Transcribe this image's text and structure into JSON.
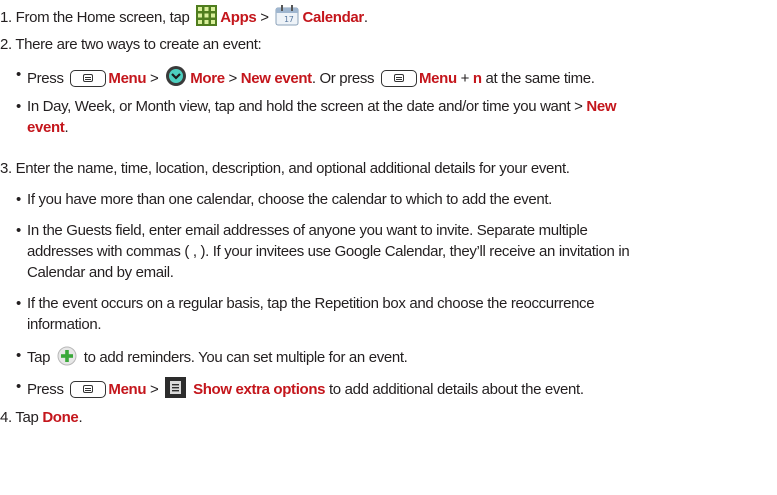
{
  "step1": {
    "prefix": "1. From the Home screen, tap",
    "apps": "Apps",
    "sep": ">",
    "calendar": "Calendar",
    "end": "."
  },
  "step2": {
    "text": "2. There are two ways to create an event:"
  },
  "b1": {
    "press": "Press",
    "menu": "Menu",
    "sep": ">",
    "more": "More",
    "sep2": ">",
    "new_event": "New event",
    "mid": ". Or press",
    "menu2": "Menu",
    "plus": "+",
    "n": "n",
    "end": "at the same time."
  },
  "b2": {
    "line1": "In Day, Week, or Month view, tap and hold the screen at the date and/or time you want >",
    "new": "New",
    "event": "event",
    "end": "."
  },
  "step3": {
    "text": "3. Enter the name, time, location, description, and optional additional details for your event."
  },
  "b3": {
    "text": "If you have more than one calendar, choose the calendar to which to add the event."
  },
  "b4": {
    "line1": "In the Guests field, enter email addresses of anyone you want to invite. Separate multiple",
    "line2": "addresses with commas ( , ). If your invitees use Google Calendar, they’ll receive an invitation in",
    "line3": "Calendar and by email."
  },
  "b5": {
    "line1": "If the event occurs on a regular basis, tap the Repetition box and choose the reoccurrence",
    "line2": "information."
  },
  "b6": {
    "tap": "Tap",
    "rest": "to add reminders. You can set multiple for an event."
  },
  "b7": {
    "press": "Press",
    "menu": "Menu",
    "sep": ">",
    "show": "Show extra options",
    "rest": "to add additional details about the event."
  },
  "step4": {
    "prefix": "4. Tap",
    "done": "Done",
    "end": "."
  },
  "colors": {
    "accent": "#c4161c",
    "text": "#231f20"
  },
  "icons": [
    "apps-grid-icon",
    "calendar-icon",
    "menu-key-icon",
    "more-icon",
    "add-plus-icon",
    "extra-options-icon"
  ]
}
